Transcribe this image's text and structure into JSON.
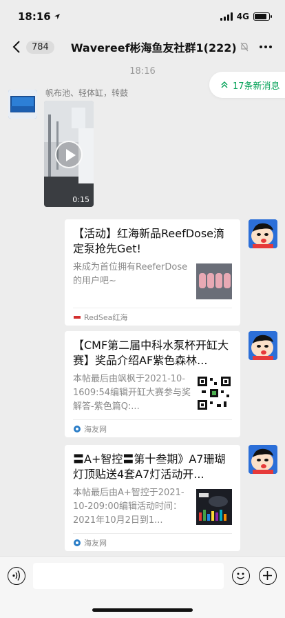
{
  "status_bar": {
    "time": "18:16",
    "network": "4G",
    "battery_level": 0.85
  },
  "header": {
    "unread_count": "784",
    "title": "Wavereef彬海鱼友社群1(222)"
  },
  "chat": {
    "timestamp": "18:16",
    "new_messages": "17条新消息"
  },
  "messages": [
    {
      "sender_name": "帆布池、轻体缸，转鼓",
      "video_duration": "0:15"
    }
  ],
  "cards": [
    {
      "title": "【活动】红海新品ReefDose滴定泵抢先Get!",
      "description": "来成为首位拥有ReeferDose的用户吧~",
      "source": "RedSea红海"
    },
    {
      "title": "【CMF第二届中科水泵杯开缸大赛】奖品介绍AF紫色森林...",
      "description": "本帖最后由飒枫于2021-10-1609:54编辑开缸大赛参与奖解答-紫色篇Q:...",
      "source": "海友网"
    },
    {
      "title": "〓A+智控〓第十叁期》A7珊瑚灯顶贴送4套A7灯活动开...",
      "description": "本帖最后由A+智控于2021-10-209:00编辑活动时间：2021年10月2日到1...",
      "source": "海友网"
    }
  ],
  "input": {
    "placeholder": ""
  },
  "colors": {
    "accent_green": "#07a35a",
    "background": "#ededed"
  }
}
